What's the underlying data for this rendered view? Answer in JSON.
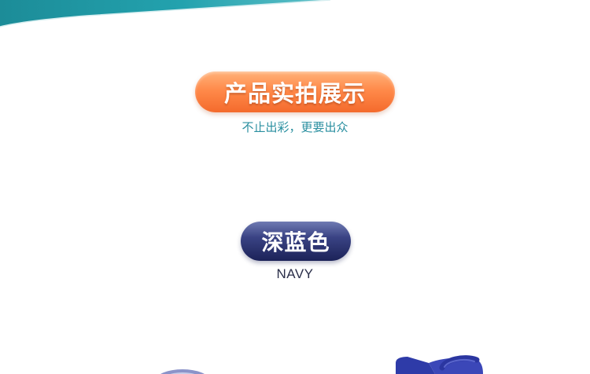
{
  "banner": {
    "title": "产品实拍展示",
    "subtitle": "不止出彩，更要出众"
  },
  "color_option": {
    "name_cn": "深蓝色",
    "name_en": "NAVY"
  },
  "colors": {
    "teal_accent": "#1f8f9c",
    "orange_pill": "#ff8a4a",
    "navy_pill": "#2a3170",
    "bag_blue": "#3b47b8"
  }
}
